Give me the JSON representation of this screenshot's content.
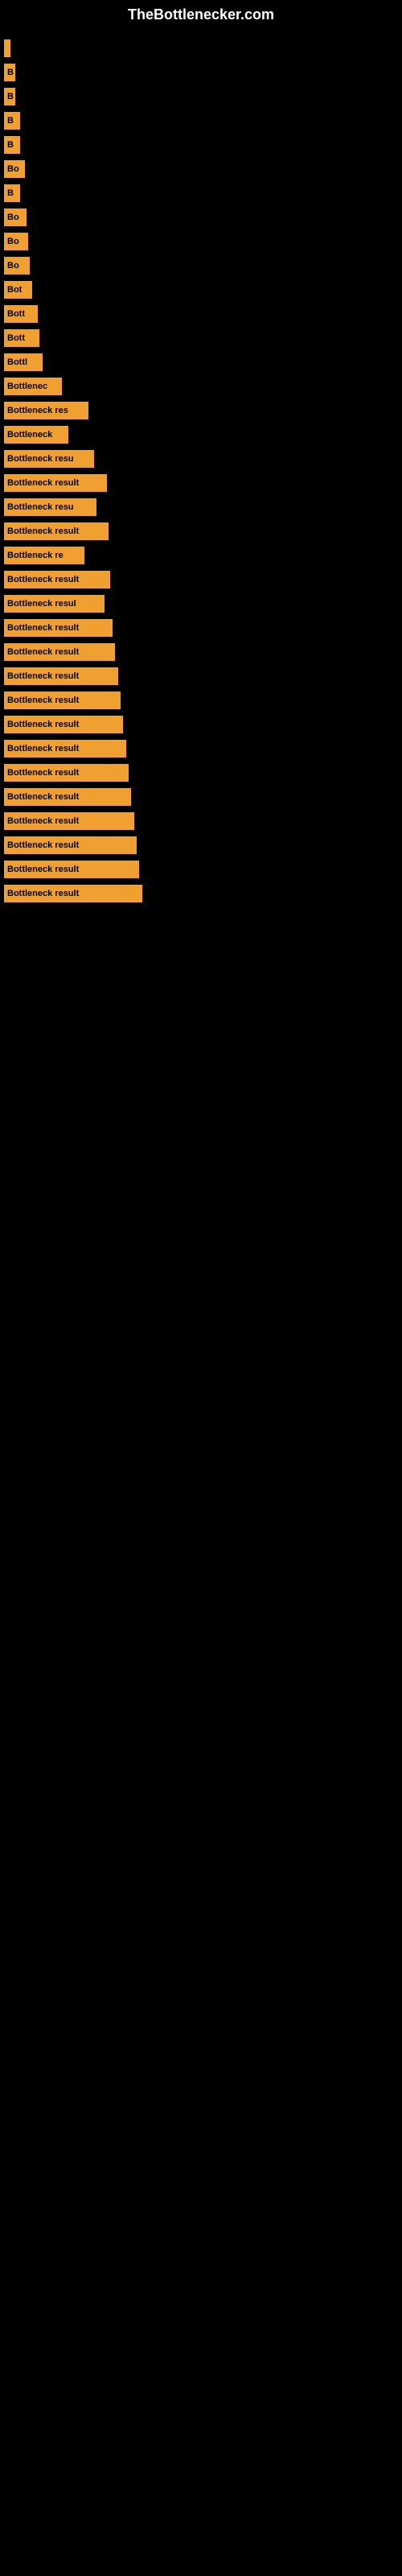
{
  "header": {
    "title": "TheBottlenecker.com"
  },
  "bars": [
    {
      "label": "",
      "width": 8
    },
    {
      "label": "B",
      "width": 14
    },
    {
      "label": "B",
      "width": 14
    },
    {
      "label": "B",
      "width": 20
    },
    {
      "label": "B",
      "width": 20
    },
    {
      "label": "Bo",
      "width": 26
    },
    {
      "label": "B",
      "width": 20
    },
    {
      "label": "Bo",
      "width": 28
    },
    {
      "label": "Bo",
      "width": 30
    },
    {
      "label": "Bo",
      "width": 32
    },
    {
      "label": "Bot",
      "width": 35
    },
    {
      "label": "Bott",
      "width": 42
    },
    {
      "label": "Bott",
      "width": 44
    },
    {
      "label": "Bottl",
      "width": 48
    },
    {
      "label": "Bottlenec",
      "width": 72
    },
    {
      "label": "Bottleneck res",
      "width": 105
    },
    {
      "label": "Bottleneck",
      "width": 80
    },
    {
      "label": "Bottleneck resu",
      "width": 112
    },
    {
      "label": "Bottleneck result",
      "width": 128
    },
    {
      "label": "Bottleneck resu",
      "width": 115
    },
    {
      "label": "Bottleneck result",
      "width": 130
    },
    {
      "label": "Bottleneck re",
      "width": 100
    },
    {
      "label": "Bottleneck result",
      "width": 132
    },
    {
      "label": "Bottleneck resul",
      "width": 125
    },
    {
      "label": "Bottleneck result",
      "width": 135
    },
    {
      "label": "Bottleneck result",
      "width": 138
    },
    {
      "label": "Bottleneck result",
      "width": 142
    },
    {
      "label": "Bottleneck result",
      "width": 145
    },
    {
      "label": "Bottleneck result",
      "width": 148
    },
    {
      "label": "Bottleneck result",
      "width": 152
    },
    {
      "label": "Bottleneck result",
      "width": 155
    },
    {
      "label": "Bottleneck result",
      "width": 158
    },
    {
      "label": "Bottleneck result",
      "width": 162
    },
    {
      "label": "Bottleneck result",
      "width": 165
    },
    {
      "label": "Bottleneck result",
      "width": 168
    },
    {
      "label": "Bottleneck result",
      "width": 172
    }
  ]
}
